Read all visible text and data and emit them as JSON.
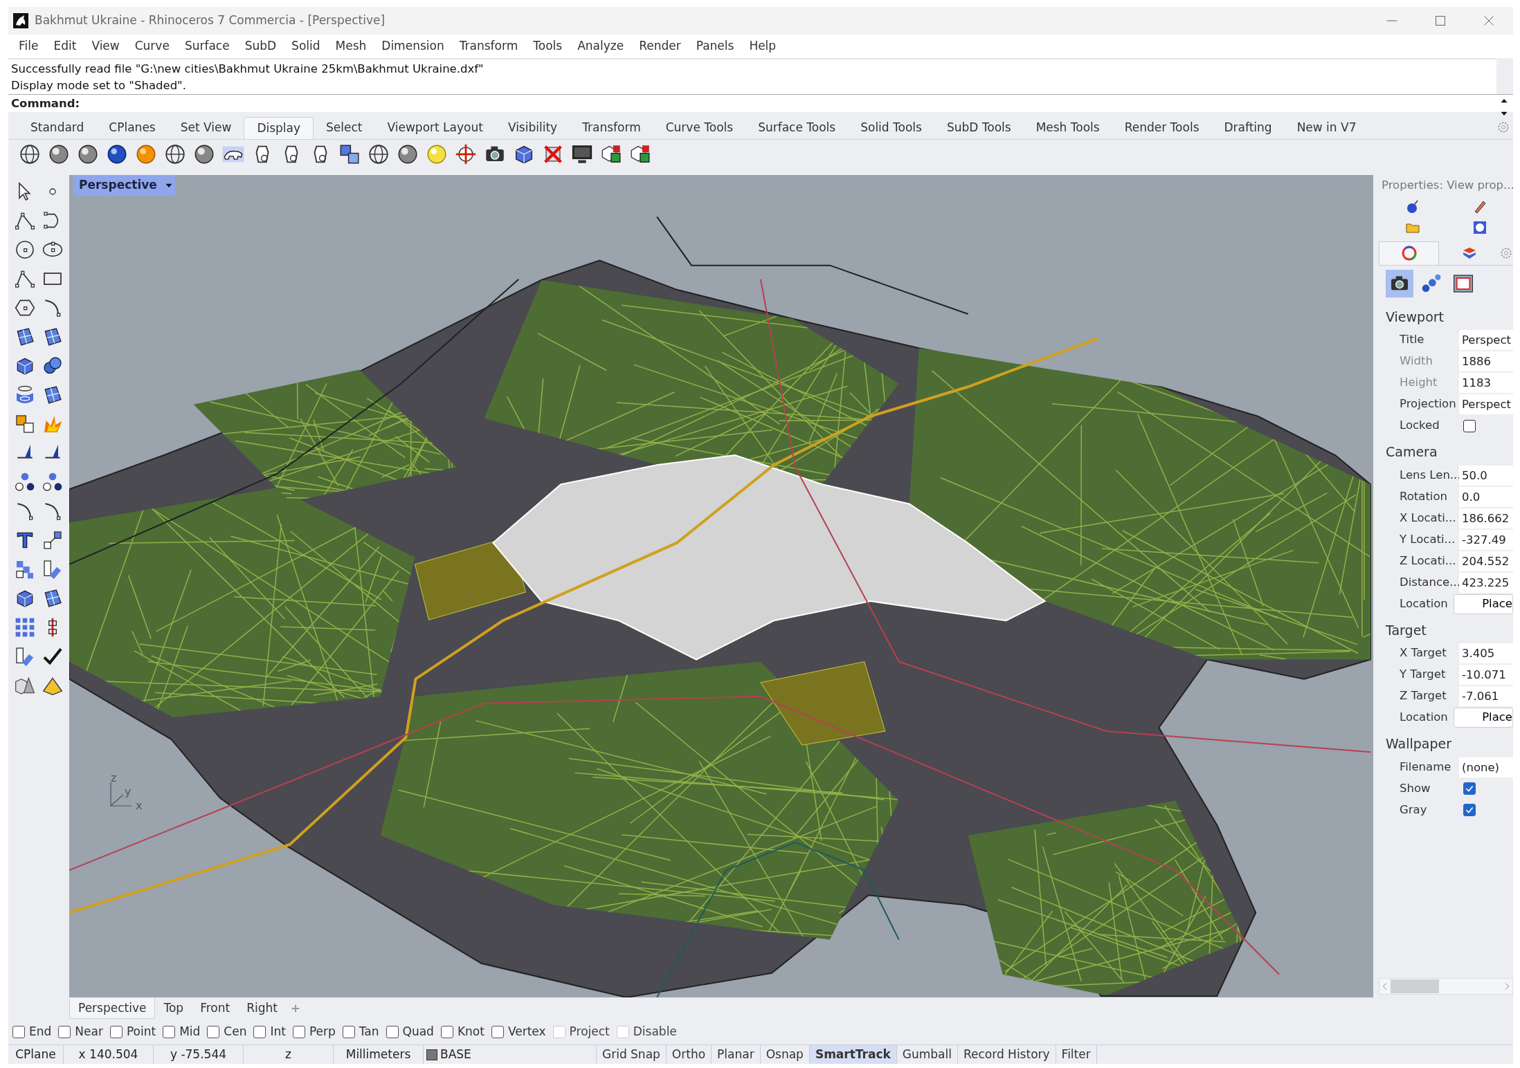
{
  "window": {
    "title": "Bakhmut Ukraine - Rhinoceros 7 Commercia - [Perspective]"
  },
  "menu": [
    "File",
    "Edit",
    "View",
    "Curve",
    "Surface",
    "SubD",
    "Solid",
    "Mesh",
    "Dimension",
    "Transform",
    "Tools",
    "Analyze",
    "Render",
    "Panels",
    "Help"
  ],
  "command_history": [
    "Successfully read file \"G:\\new cities\\Bakhmut Ukraine 25km\\Bakhmut Ukraine.dxf\"",
    "Display mode set to \"Shaded\"."
  ],
  "command_prompt": "Command:",
  "toolbar_tabs": [
    {
      "label": "Standard",
      "selected": false
    },
    {
      "label": "CPlanes",
      "selected": false
    },
    {
      "label": "Set View",
      "selected": false
    },
    {
      "label": "Display",
      "selected": true
    },
    {
      "label": "Select",
      "selected": false
    },
    {
      "label": "Viewport Layout",
      "selected": false
    },
    {
      "label": "Visibility",
      "selected": false
    },
    {
      "label": "Transform",
      "selected": false
    },
    {
      "label": "Curve Tools",
      "selected": false
    },
    {
      "label": "Surface Tools",
      "selected": false
    },
    {
      "label": "Solid Tools",
      "selected": false
    },
    {
      "label": "SubD Tools",
      "selected": false
    },
    {
      "label": "Mesh Tools",
      "selected": false
    },
    {
      "label": "Render Tools",
      "selected": false
    },
    {
      "label": "Drafting",
      "selected": false
    },
    {
      "label": "New in V7",
      "selected": false
    }
  ],
  "viewport": {
    "title": "Perspective",
    "axes": [
      "z",
      "y",
      "x"
    ]
  },
  "viewport_tabs": [
    {
      "label": "Perspective",
      "selected": true
    },
    {
      "label": "Top",
      "selected": false
    },
    {
      "label": "Front",
      "selected": false
    },
    {
      "label": "Right",
      "selected": false
    }
  ],
  "properties": {
    "title": "Properties: View prop...",
    "panel_tabs": [
      {
        "selected": true
      },
      {
        "selected": false
      }
    ],
    "pages": [
      {
        "selected": true
      },
      {
        "selected": false
      },
      {
        "selected": false
      }
    ],
    "sections": [
      {
        "title": "Viewport",
        "rows": [
          {
            "label": "Title",
            "kind": "text",
            "value": "Perspect",
            "disabled": false
          },
          {
            "label": "Width",
            "kind": "text",
            "value": "1886",
            "disabled": true
          },
          {
            "label": "Height",
            "kind": "text",
            "value": "1183",
            "disabled": true
          },
          {
            "label": "Projection",
            "kind": "text",
            "value": "Perspect",
            "disabled": false
          },
          {
            "label": "Locked",
            "kind": "checkbox",
            "checked": false,
            "disabled": false
          }
        ]
      },
      {
        "title": "Camera",
        "rows": [
          {
            "label": "Lens Len...",
            "kind": "text",
            "value": "50.0",
            "disabled": false
          },
          {
            "label": "Rotation",
            "kind": "text",
            "value": "0.0",
            "disabled": false
          },
          {
            "label": "X Locati...",
            "kind": "text",
            "value": "186.662",
            "disabled": false
          },
          {
            "label": "Y Locati...",
            "kind": "text",
            "value": "-327.49",
            "disabled": false
          },
          {
            "label": "Z Locati...",
            "kind": "text",
            "value": "204.552",
            "disabled": false
          },
          {
            "label": "Distance...",
            "kind": "text",
            "value": "423.225",
            "disabled": false
          },
          {
            "label": "Location",
            "kind": "button",
            "value": "Place",
            "disabled": false
          }
        ]
      },
      {
        "title": "Target",
        "rows": [
          {
            "label": "X Target",
            "kind": "text",
            "value": "3.405",
            "disabled": false
          },
          {
            "label": "Y Target",
            "kind": "text",
            "value": "-10.071",
            "disabled": false
          },
          {
            "label": "Z Target",
            "kind": "text",
            "value": "-7.061",
            "disabled": false
          },
          {
            "label": "Location",
            "kind": "button",
            "value": "Place",
            "disabled": false
          }
        ]
      },
      {
        "title": "Wallpaper",
        "rows": [
          {
            "label": "Filename",
            "kind": "text",
            "value": "(none)",
            "disabled": false
          },
          {
            "label": "Show",
            "kind": "checkbox",
            "checked": true,
            "disabled": false
          },
          {
            "label": "Gray",
            "kind": "checkbox",
            "checked": true,
            "disabled": false
          }
        ]
      }
    ]
  },
  "osnaps": [
    {
      "label": "End",
      "checked": false,
      "disabled": false
    },
    {
      "label": "Near",
      "checked": false,
      "disabled": false
    },
    {
      "label": "Point",
      "checked": false,
      "disabled": false
    },
    {
      "label": "Mid",
      "checked": false,
      "disabled": false
    },
    {
      "label": "Cen",
      "checked": false,
      "disabled": false
    },
    {
      "label": "Int",
      "checked": false,
      "disabled": false
    },
    {
      "label": "Perp",
      "checked": false,
      "disabled": false
    },
    {
      "label": "Tan",
      "checked": false,
      "disabled": false
    },
    {
      "label": "Quad",
      "checked": false,
      "disabled": false
    },
    {
      "label": "Knot",
      "checked": false,
      "disabled": false
    },
    {
      "label": "Vertex",
      "checked": false,
      "disabled": false
    },
    {
      "label": "Project",
      "checked": false,
      "disabled": true
    },
    {
      "label": "Disable",
      "checked": false,
      "disabled": true
    }
  ],
  "status_bar": {
    "cplane": "CPlane",
    "x": "x 140.504",
    "y": "y -75.544",
    "z": "z",
    "units": "Millimeters",
    "layer": "BASE",
    "toggles": [
      {
        "label": "Grid Snap",
        "on": false
      },
      {
        "label": "Ortho",
        "on": false
      },
      {
        "label": "Planar",
        "on": false
      },
      {
        "label": "Osnap",
        "on": false
      },
      {
        "label": "SmartTrack",
        "on": true
      },
      {
        "label": "Gumball",
        "on": false
      },
      {
        "label": "Record History",
        "on": false
      },
      {
        "label": "Filter",
        "on": false
      }
    ]
  }
}
